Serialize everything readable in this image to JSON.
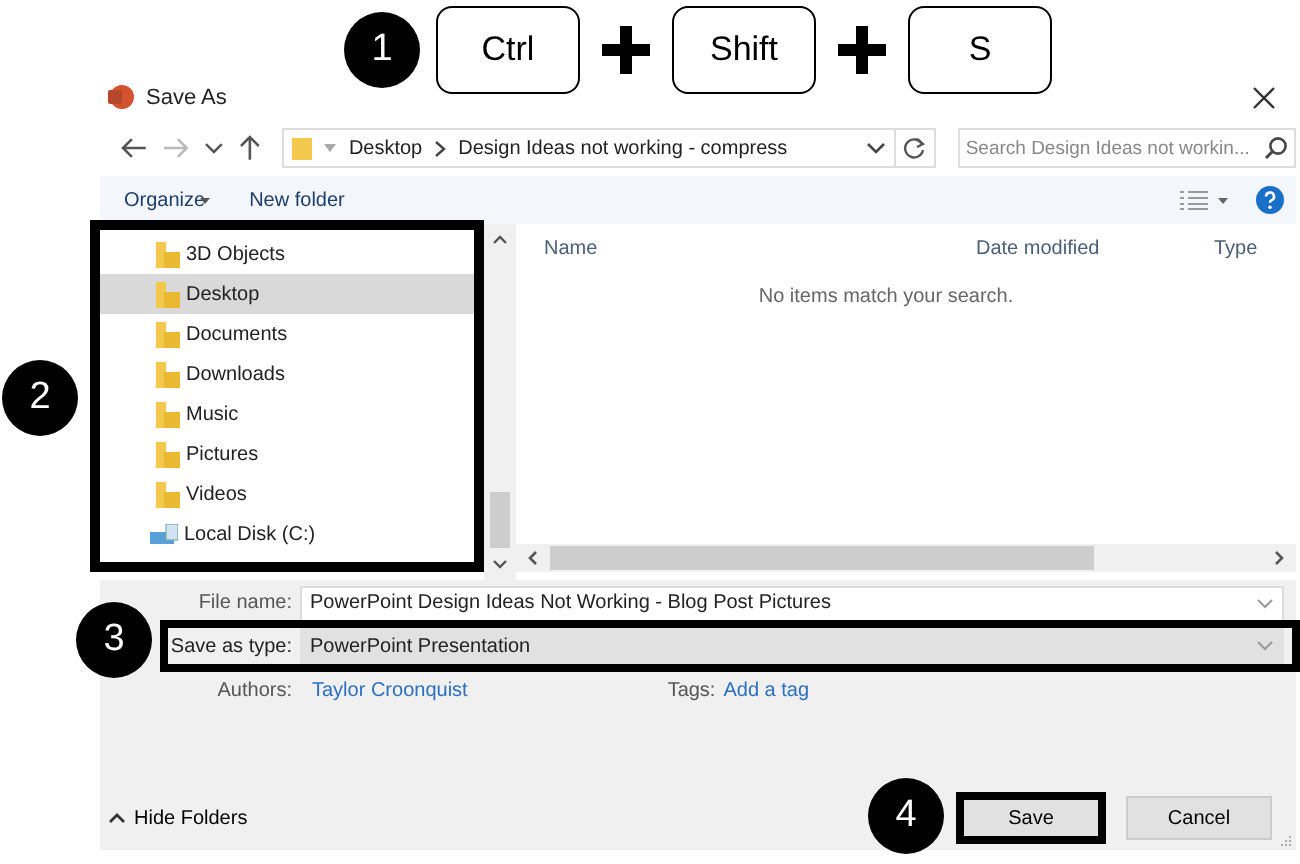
{
  "shortcut": {
    "step": "1",
    "keys": [
      "Ctrl",
      "Shift",
      "S"
    ]
  },
  "window": {
    "title": "Save As"
  },
  "address": {
    "crumbs": [
      "Desktop",
      "Design Ideas not working - compress"
    ],
    "search_placeholder": "Search Design Ideas not workin..."
  },
  "toolbar": {
    "organize": "Organize",
    "new_folder": "New folder"
  },
  "nav": {
    "items": [
      {
        "label": "3D Objects",
        "kind": "folder",
        "selected": false
      },
      {
        "label": "Desktop",
        "kind": "folder",
        "selected": true
      },
      {
        "label": "Documents",
        "kind": "folder",
        "selected": false
      },
      {
        "label": "Downloads",
        "kind": "folder",
        "selected": false
      },
      {
        "label": "Music",
        "kind": "folder",
        "selected": false
      },
      {
        "label": "Pictures",
        "kind": "folder",
        "selected": false
      },
      {
        "label": "Videos",
        "kind": "folder",
        "selected": false
      },
      {
        "label": "Local Disk (C:)",
        "kind": "drive",
        "selected": false
      }
    ]
  },
  "table": {
    "columns": [
      "Name",
      "Date modified",
      "Type"
    ],
    "empty_message": "No items match your search."
  },
  "form": {
    "file_name": {
      "label": "File name:",
      "value": "PowerPoint Design Ideas Not Working - Blog Post Pictures"
    },
    "save_as_type": {
      "label": "Save as type:",
      "value": "PowerPoint Presentation"
    },
    "authors": {
      "label": "Authors:",
      "value": "Taylor Croonquist"
    },
    "tags": {
      "label": "Tags:",
      "value": "Add a tag"
    }
  },
  "hide_folders": "Hide Folders",
  "buttons": [
    "Save",
    "Cancel"
  ],
  "steps": [
    "2",
    "3",
    "4"
  ]
}
